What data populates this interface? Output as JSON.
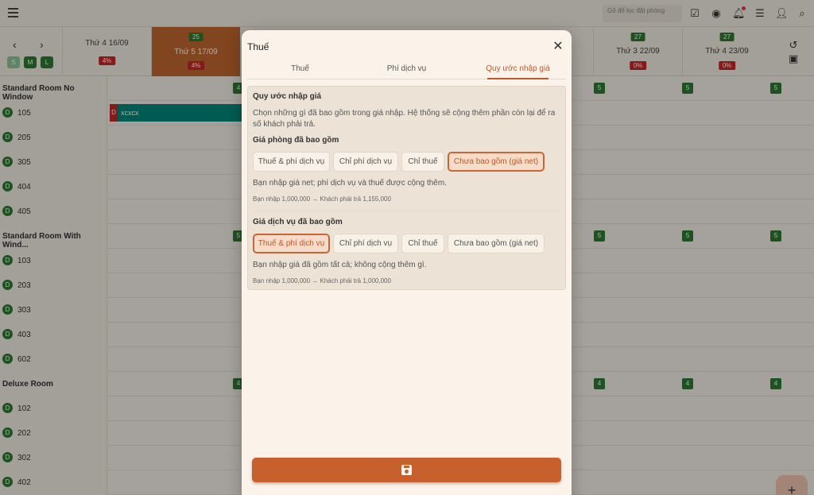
{
  "topbar": {
    "search_placeholder": "Gõ để lọc đặt phòng"
  },
  "datebar": {
    "size_filters": [
      "S",
      "M",
      "L"
    ],
    "days": [
      {
        "label": "Thứ 4 16/09",
        "pct": "4%",
        "avail": ""
      },
      {
        "label": "Thứ 5 17/09",
        "pct": "4%",
        "avail": "25"
      },
      {
        "label": "Thứ 3 22/09",
        "pct": "0%",
        "avail": "27"
      },
      {
        "label": "Thứ 4 23/09",
        "pct": "0%",
        "avail": "27"
      }
    ]
  },
  "grid": {
    "groups": [
      {
        "title": "Standard Room No Window",
        "count": "5",
        "left_count": "4",
        "rooms": [
          "105",
          "205",
          "305",
          "404",
          "405"
        ]
      },
      {
        "title": "Standard Room With Wind...",
        "count": "5",
        "left_count": "5",
        "rooms": [
          "103",
          "203",
          "303",
          "403",
          "602"
        ]
      },
      {
        "title": "Deluxe Room",
        "count": "4",
        "left_count": "4",
        "rooms": [
          "102",
          "202",
          "302",
          "402"
        ]
      }
    ],
    "room_status": "D",
    "booking": {
      "status": "D",
      "guest": "xcxcx"
    }
  },
  "modal": {
    "title": "Thuế",
    "tabs": [
      "Thuế",
      "Phí dịch vụ",
      "Quy ước nhập giá"
    ],
    "active_tab": 2,
    "card_title": "Quy ước nhập giá",
    "card_desc": "Chọn những gì đã bao gồm trong giá nhập. Hệ thống sẽ cộng thêm phần còn lại để ra số khách phải trả.",
    "room_price": {
      "title": "Giá phòng đã bao gồm",
      "options": [
        "Thuế & phí dịch vụ",
        "Chỉ phí dịch vụ",
        "Chỉ thuế",
        "Chưa bao gồm (giá net)"
      ],
      "selected": 3,
      "note": "Bạn nhập giá net; phí dịch vụ và thuế được cộng thêm.",
      "example": "Bạn nhập 1,000,000 → Khách phải trả 1,155,000"
    },
    "service_price": {
      "title": "Giá dịch vụ đã bao gồm",
      "options": [
        "Thuế & phí dịch vụ",
        "Chỉ phí dịch vụ",
        "Chỉ thuế",
        "Chưa bao gồm (giá net)"
      ],
      "selected": 0,
      "note": "Bạn nhập giá đã gồm tất cả; không cộng thêm gì.",
      "example": "Bạn nhập 1,000,000 → Khách phải trả 1,000,000"
    }
  },
  "colors": {
    "accent": "#c8602e",
    "available": "#2e7d32",
    "occupancy": "#c62828",
    "booking": "#00897b"
  },
  "fab_label": "+"
}
